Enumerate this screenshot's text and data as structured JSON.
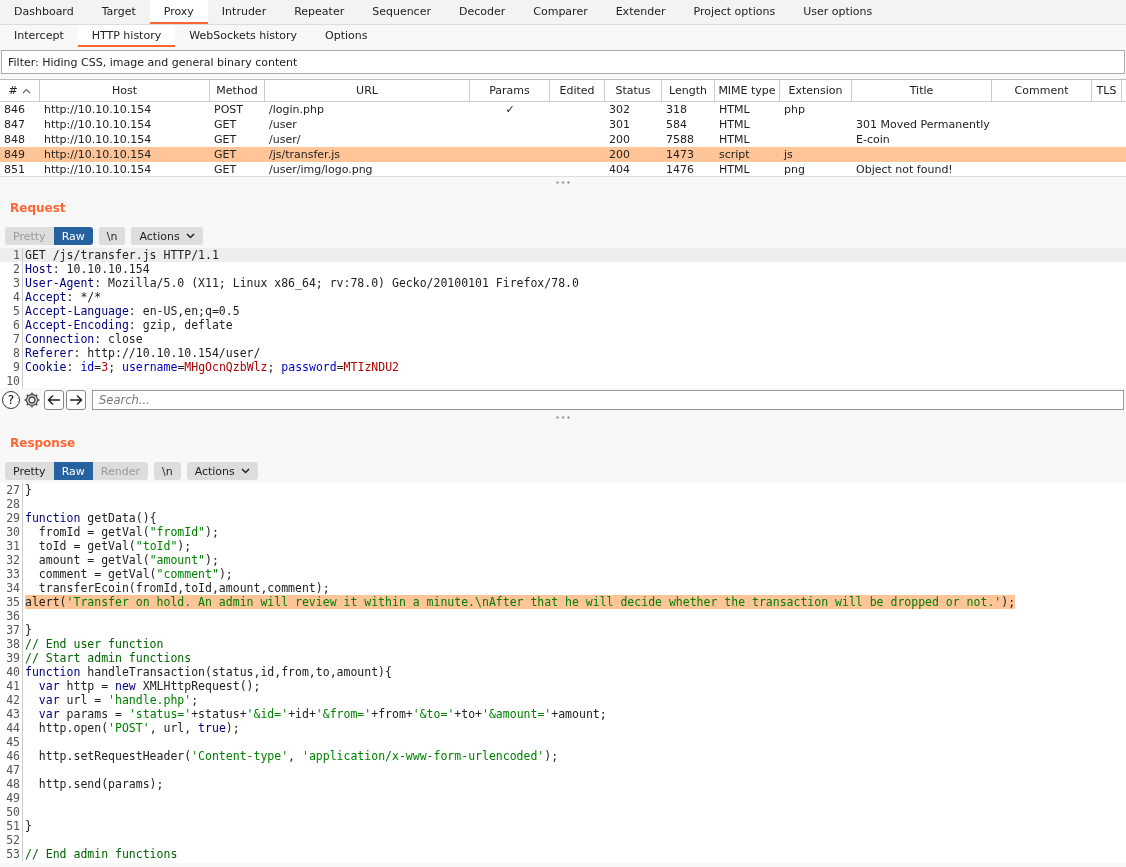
{
  "main_tabs": [
    {
      "label": "Dashboard",
      "selected": false
    },
    {
      "label": "Target",
      "selected": false
    },
    {
      "label": "Proxy",
      "selected": true
    },
    {
      "label": "Intruder",
      "selected": false
    },
    {
      "label": "Repeater",
      "selected": false
    },
    {
      "label": "Sequencer",
      "selected": false
    },
    {
      "label": "Decoder",
      "selected": false
    },
    {
      "label": "Comparer",
      "selected": false
    },
    {
      "label": "Extender",
      "selected": false
    },
    {
      "label": "Project options",
      "selected": false
    },
    {
      "label": "User options",
      "selected": false
    }
  ],
  "sub_tabs": [
    {
      "label": "Intercept",
      "selected": false
    },
    {
      "label": "HTTP history",
      "selected": true
    },
    {
      "label": "WebSockets history",
      "selected": false
    },
    {
      "label": "Options",
      "selected": false
    }
  ],
  "filter": "Filter: Hiding CSS, image and general binary content",
  "table": {
    "columns": [
      {
        "label": "#",
        "sorted": true
      },
      {
        "label": "Host",
        "sorted": false
      },
      {
        "label": "Method",
        "sorted": false
      },
      {
        "label": "URL",
        "sorted": false
      },
      {
        "label": "Params",
        "sorted": false
      },
      {
        "label": "Edited",
        "sorted": false
      },
      {
        "label": "Status",
        "sorted": false
      },
      {
        "label": "Length",
        "sorted": false
      },
      {
        "label": "MIME type",
        "sorted": false
      },
      {
        "label": "Extension",
        "sorted": false
      },
      {
        "label": "Title",
        "sorted": false
      },
      {
        "label": "Comment",
        "sorted": false
      },
      {
        "label": "TLS",
        "sorted": false
      }
    ],
    "rows": [
      {
        "selected": false,
        "number": "846",
        "host": "http://10.10.10.154",
        "method": "POST",
        "url": "/login.php",
        "params": "✓",
        "status": "302",
        "length": "318",
        "mime_type": "HTML",
        "extension": "php"
      },
      {
        "selected": false,
        "number": "847",
        "host": "http://10.10.10.154",
        "method": "GET",
        "url": "/user",
        "status": "301",
        "length": "584",
        "mime_type": "HTML",
        "title": "301 Moved Permanently"
      },
      {
        "selected": false,
        "number": "848",
        "host": "http://10.10.10.154",
        "method": "GET",
        "url": "/user/",
        "status": "200",
        "length": "7588",
        "mime_type": "HTML",
        "title": "E-coin"
      },
      {
        "selected": true,
        "number": "849",
        "host": "http://10.10.10.154",
        "method": "GET",
        "url": "/js/transfer.js",
        "status": "200",
        "length": "1473",
        "mime_type": "script",
        "extension": "js"
      },
      {
        "selected": false,
        "number": "851",
        "host": "http://10.10.10.154",
        "method": "GET",
        "url": "/user/img/logo.png",
        "status": "404",
        "length": "1476",
        "mime_type": "HTML",
        "extension": "png",
        "title": "Object not found!"
      }
    ]
  },
  "request": {
    "title": "Request",
    "buttons": [
      {
        "label": "Pretty",
        "selected": false,
        "disabled": true
      },
      {
        "label": "Raw",
        "selected": true,
        "disabled": false
      },
      {
        "label": "\\n",
        "selected": false,
        "disabled": false
      }
    ],
    "actions": "Actions",
    "lines": [
      {
        "n": "1",
        "current": true,
        "selected": false,
        "tokens": [
          {
            "kind": "plain",
            "text": "GET /js/transfer.js HTTP/1.1"
          }
        ]
      },
      {
        "n": "2",
        "current": false,
        "selected": false,
        "tokens": [
          {
            "kind": "header",
            "text": "Host"
          },
          {
            "kind": "plain",
            "text": ": 10.10.10.154"
          }
        ]
      },
      {
        "n": "3",
        "current": false,
        "selected": false,
        "tokens": [
          {
            "kind": "header",
            "text": "User-Agent"
          },
          {
            "kind": "plain",
            "text": ": Mozilla/5.0 (X11; Linux x86_64; rv:78.0) Gecko/20100101 Firefox/78.0"
          }
        ]
      },
      {
        "n": "4",
        "current": false,
        "selected": false,
        "tokens": [
          {
            "kind": "header",
            "text": "Accept"
          },
          {
            "kind": "plain",
            "text": ": */*"
          }
        ]
      },
      {
        "n": "5",
        "current": false,
        "selected": false,
        "tokens": [
          {
            "kind": "header",
            "text": "Accept-Language"
          },
          {
            "kind": "plain",
            "text": ": en-US,en;q=0.5"
          }
        ]
      },
      {
        "n": "6",
        "current": false,
        "selected": false,
        "tokens": [
          {
            "kind": "header",
            "text": "Accept-Encoding"
          },
          {
            "kind": "plain",
            "text": ": gzip, deflate"
          }
        ]
      },
      {
        "n": "7",
        "current": false,
        "selected": false,
        "tokens": [
          {
            "kind": "header",
            "text": "Connection"
          },
          {
            "kind": "plain",
            "text": ": close"
          }
        ]
      },
      {
        "n": "8",
        "current": false,
        "selected": false,
        "tokens": [
          {
            "kind": "header",
            "text": "Referer"
          },
          {
            "kind": "plain",
            "text": ": http://10.10.10.154/user/"
          }
        ]
      },
      {
        "n": "9",
        "current": false,
        "selected": false,
        "tokens": [
          {
            "kind": "header",
            "text": "Cookie"
          },
          {
            "kind": "plain",
            "text": ": "
          },
          {
            "kind": "cookie_key",
            "text": "id"
          },
          {
            "kind": "plain",
            "text": "="
          },
          {
            "kind": "cookie_value",
            "text": "3"
          },
          {
            "kind": "plain",
            "text": "; "
          },
          {
            "kind": "cookie_key",
            "text": "username"
          },
          {
            "kind": "plain",
            "text": "="
          },
          {
            "kind": "cookie_value",
            "text": "MHgOcnQzbWlz"
          },
          {
            "kind": "plain",
            "text": "; "
          },
          {
            "kind": "cookie_key",
            "text": "password"
          },
          {
            "kind": "plain",
            "text": "="
          },
          {
            "kind": "cookie_value",
            "text": "MTIzNDU2"
          }
        ]
      },
      {
        "n": "10",
        "current": false,
        "selected": false
      }
    ],
    "help": "?",
    "search": {
      "placeholder": "Search..."
    }
  },
  "response": {
    "title": "Response",
    "buttons": [
      {
        "label": "Pretty",
        "selected": false,
        "disabled": false
      },
      {
        "label": "Raw",
        "selected": true,
        "disabled": false
      },
      {
        "label": "Render",
        "selected": false,
        "disabled": true
      },
      {
        "label": "\\n",
        "selected": false,
        "disabled": false
      }
    ],
    "actions": "Actions",
    "lines": [
      {
        "n": "27",
        "current": false,
        "selected": false,
        "tokens": [
          {
            "kind": "plain",
            "text": "}"
          }
        ]
      },
      {
        "n": "28",
        "current": false,
        "selected": false
      },
      {
        "n": "29",
        "current": false,
        "selected": false,
        "tokens": [
          {
            "kind": "keyword",
            "text": "function"
          },
          {
            "kind": "plain",
            "text": " getData(){"
          }
        ]
      },
      {
        "n": "30",
        "current": false,
        "selected": false,
        "tokens": [
          {
            "kind": "plain",
            "text": "  fromId = getVal("
          },
          {
            "kind": "string",
            "text": "\"fromId\""
          },
          {
            "kind": "plain",
            "text": ");"
          }
        ]
      },
      {
        "n": "31",
        "current": false,
        "selected": false,
        "tokens": [
          {
            "kind": "plain",
            "text": "  toId = getVal("
          },
          {
            "kind": "string",
            "text": "\"toId\""
          },
          {
            "kind": "plain",
            "text": ");"
          }
        ]
      },
      {
        "n": "32",
        "current": false,
        "selected": false,
        "tokens": [
          {
            "kind": "plain",
            "text": "  amount = getVal("
          },
          {
            "kind": "string",
            "text": "\"amount\""
          },
          {
            "kind": "plain",
            "text": ");"
          }
        ]
      },
      {
        "n": "33",
        "current": false,
        "selected": false,
        "tokens": [
          {
            "kind": "plain",
            "text": "  comment = getVal("
          },
          {
            "kind": "string",
            "text": "\"comment\""
          },
          {
            "kind": "plain",
            "text": ");"
          }
        ]
      },
      {
        "n": "34",
        "current": false,
        "selected": false,
        "tokens": [
          {
            "kind": "plain",
            "text": "  transferEcoin(fromId,toId,amount,comment);"
          }
        ]
      },
      {
        "n": "35",
        "current": false,
        "selected": true,
        "tokens": [
          {
            "kind": "plain",
            "text": "alert("
          },
          {
            "kind": "string",
            "text": "'Transfer on hold. An admin will review it within a minute.\\nAfter that he will decide whether the transaction will be dropped or not.'"
          },
          {
            "kind": "plain",
            "text": ");"
          }
        ]
      },
      {
        "n": "36",
        "current": false,
        "selected": false
      },
      {
        "n": "37",
        "current": false,
        "selected": false,
        "tokens": [
          {
            "kind": "plain",
            "text": "}"
          }
        ]
      },
      {
        "n": "38",
        "current": false,
        "selected": false,
        "tokens": [
          {
            "kind": "comment",
            "text": "// End user function"
          }
        ]
      },
      {
        "n": "39",
        "current": false,
        "selected": false,
        "tokens": [
          {
            "kind": "comment",
            "text": "// Start admin functions"
          }
        ]
      },
      {
        "n": "40",
        "current": false,
        "selected": false,
        "tokens": [
          {
            "kind": "keyword",
            "text": "function"
          },
          {
            "kind": "plain",
            "text": " handleTransaction(status,id,from,to,amount){"
          }
        ]
      },
      {
        "n": "41",
        "current": false,
        "selected": false,
        "tokens": [
          {
            "kind": "keyword",
            "text": "  var"
          },
          {
            "kind": "plain",
            "text": " http = "
          },
          {
            "kind": "keyword",
            "text": "new"
          },
          {
            "kind": "plain",
            "text": " XMLHttpRequest();"
          }
        ]
      },
      {
        "n": "42",
        "current": false,
        "selected": false,
        "tokens": [
          {
            "kind": "keyword",
            "text": "  var"
          },
          {
            "kind": "plain",
            "text": " url = "
          },
          {
            "kind": "string",
            "text": "'handle.php'"
          },
          {
            "kind": "plain",
            "text": ";"
          }
        ]
      },
      {
        "n": "43",
        "current": false,
        "selected": false,
        "tokens": [
          {
            "kind": "keyword",
            "text": "  var"
          },
          {
            "kind": "plain",
            "text": " params = "
          },
          {
            "kind": "string",
            "text": "'status='"
          },
          {
            "kind": "plain",
            "text": "+status+"
          },
          {
            "kind": "string",
            "text": "'&id='"
          },
          {
            "kind": "plain",
            "text": "+id+"
          },
          {
            "kind": "string",
            "text": "'&from='"
          },
          {
            "kind": "plain",
            "text": "+from+"
          },
          {
            "kind": "string",
            "text": "'&to='"
          },
          {
            "kind": "plain",
            "text": "+to+"
          },
          {
            "kind": "string",
            "text": "'&amount='"
          },
          {
            "kind": "plain",
            "text": "+amount;"
          }
        ]
      },
      {
        "n": "44",
        "current": false,
        "selected": false,
        "tokens": [
          {
            "kind": "plain",
            "text": "  http.open("
          },
          {
            "kind": "string",
            "text": "'POST'"
          },
          {
            "kind": "plain",
            "text": ", url, "
          },
          {
            "kind": "keyword",
            "text": "true"
          },
          {
            "kind": "plain",
            "text": ");"
          }
        ]
      },
      {
        "n": "45",
        "current": false,
        "selected": false
      },
      {
        "n": "46",
        "current": false,
        "selected": false,
        "tokens": [
          {
            "kind": "plain",
            "text": "  http.setRequestHeader("
          },
          {
            "kind": "string",
            "text": "'Content-type'"
          },
          {
            "kind": "plain",
            "text": ", "
          },
          {
            "kind": "string",
            "text": "'application/x-www-form-urlencoded'"
          },
          {
            "kind": "plain",
            "text": ");"
          }
        ]
      },
      {
        "n": "47",
        "current": false,
        "selected": false
      },
      {
        "n": "48",
        "current": false,
        "selected": false,
        "tokens": [
          {
            "kind": "plain",
            "text": "  http.send(params);"
          }
        ]
      },
      {
        "n": "49",
        "current": false,
        "selected": false
      },
      {
        "n": "50",
        "current": false,
        "selected": false
      },
      {
        "n": "51",
        "current": false,
        "selected": false,
        "tokens": [
          {
            "kind": "plain",
            "text": "}"
          }
        ]
      },
      {
        "n": "52",
        "current": false,
        "selected": false
      },
      {
        "n": "53",
        "current": false,
        "selected": false,
        "tokens": [
          {
            "kind": "comment",
            "text": "// End admin functions"
          }
        ]
      }
    ]
  }
}
